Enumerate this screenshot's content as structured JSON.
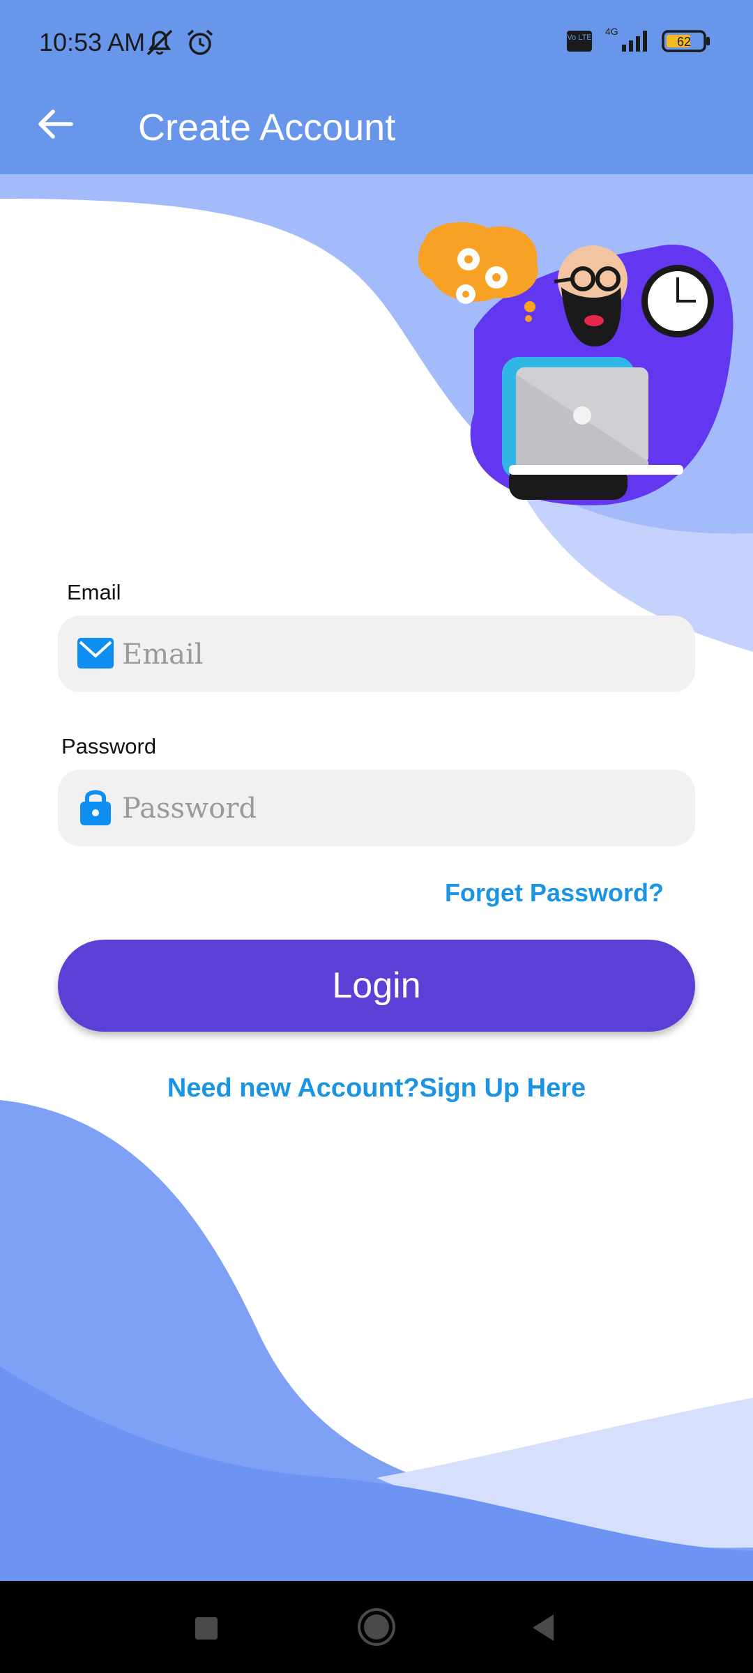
{
  "status_bar": {
    "time": "10:53 AM",
    "battery": "62",
    "network": "4G",
    "volte": "Vo LTE",
    "icons": [
      "mute-icon",
      "alarm-icon",
      "volte-icon",
      "signal-icon",
      "battery-icon"
    ]
  },
  "app_bar": {
    "title": "Create Account",
    "back_icon": "arrow-left-icon"
  },
  "form": {
    "email_label": "Email",
    "email_placeholder": "Email",
    "email_icon": "envelope-icon",
    "password_label": "Password",
    "password_placeholder": "Password",
    "password_icon": "lock-icon",
    "forgot_password": "Forget Password?",
    "login_button": "Login",
    "signup_link": "Need new Account?Sign Up Here"
  },
  "nav_bar": {
    "icons": [
      "recents-square-icon",
      "home-circle-icon",
      "back-triangle-icon"
    ]
  },
  "colors": {
    "header": "#6896ea",
    "accent_button": "#5c40d6",
    "link": "#1b94e4",
    "input_bg": "#f2f0f0"
  }
}
